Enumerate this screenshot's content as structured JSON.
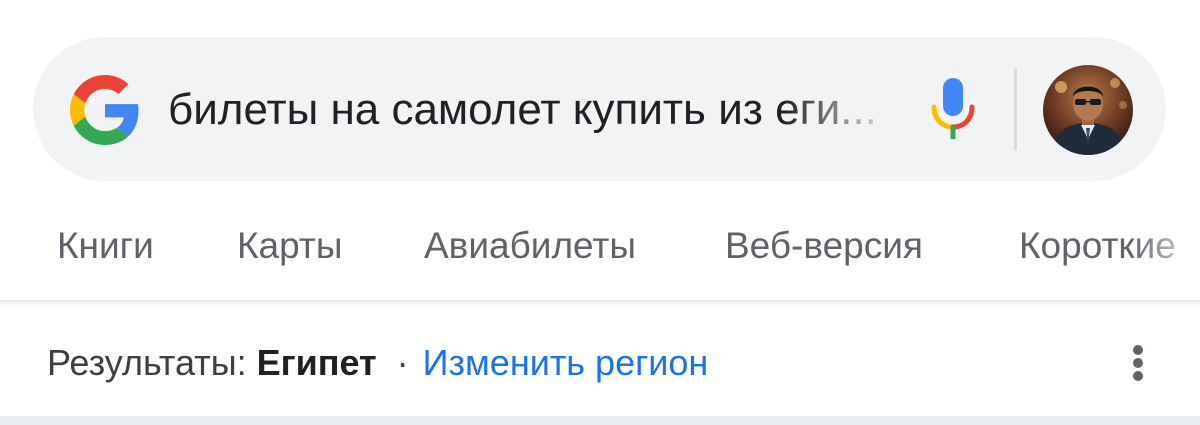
{
  "search": {
    "query": "билеты на самолет купить из еги..."
  },
  "icons": {
    "logo": "google-g-icon",
    "mic": "microphone-icon",
    "menu": "more-vert-icon"
  },
  "tabs": [
    {
      "label": "Книги"
    },
    {
      "label": "Карты"
    },
    {
      "label": "Авиабилеты"
    },
    {
      "label": "Веб-версия"
    },
    {
      "label": "Короткие"
    }
  ],
  "region": {
    "prefix": "Результаты: ",
    "name": "Египет",
    "separator": "·",
    "change_link": "Изменить регион"
  },
  "colors": {
    "search_bg": "#f1f3f4",
    "link": "#1a73e8",
    "tab_text": "#5f6368",
    "google_blue": "#4285f4",
    "google_red": "#ea4335",
    "google_yellow": "#fbbc05",
    "google_green": "#34a853"
  }
}
